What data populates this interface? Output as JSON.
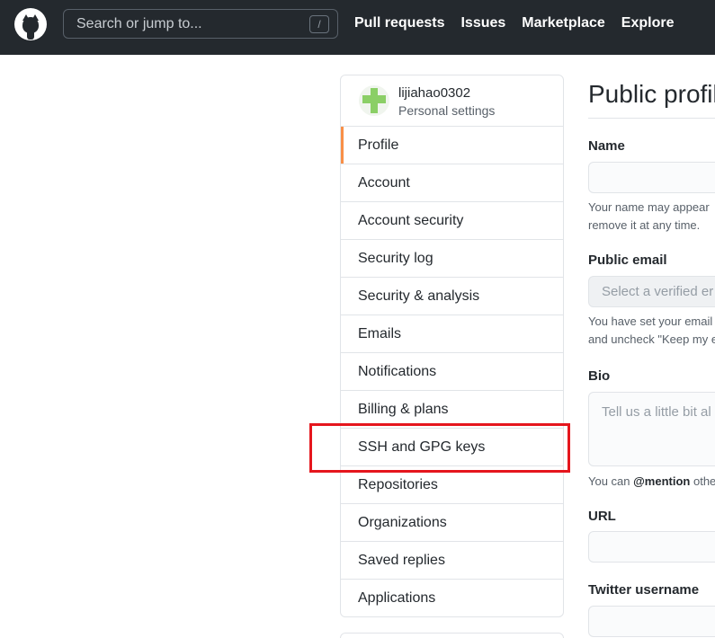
{
  "header": {
    "search_placeholder": "Search or jump to...",
    "search_shortcut": "/",
    "nav": [
      "Pull requests",
      "Issues",
      "Marketplace",
      "Explore"
    ]
  },
  "sidebar": {
    "username": "lijiahao0302",
    "subtitle": "Personal settings",
    "items": [
      {
        "label": "Profile",
        "selected": true
      },
      {
        "label": "Account"
      },
      {
        "label": "Account security"
      },
      {
        "label": "Security log"
      },
      {
        "label": "Security & analysis"
      },
      {
        "label": "Emails"
      },
      {
        "label": "Notifications"
      },
      {
        "label": "Billing & plans"
      },
      {
        "label": "SSH and GPG keys",
        "highlighted": true
      },
      {
        "label": "Repositories"
      },
      {
        "label": "Organizations"
      },
      {
        "label": "Saved replies"
      },
      {
        "label": "Applications"
      }
    ]
  },
  "main": {
    "title": "Public profil",
    "name_label": "Name",
    "name_note_1": "Your name may appear",
    "name_note_2": "remove it at any time.",
    "email_label": "Public email",
    "email_placeholder": "Select a verified er",
    "email_note_1": "You have set your email",
    "email_note_2": "and uncheck \"Keep my e",
    "bio_label": "Bio",
    "bio_placeholder": "Tell us a little bit al",
    "bio_note_prefix": "You can ",
    "bio_note_mention": "@mention",
    "bio_note_suffix": " othe",
    "url_label": "URL",
    "twitter_label": "Twitter username"
  },
  "colors": {
    "header_bg": "#24292e",
    "selected_marker": "#f66a0a",
    "highlight_box": "#e5161d"
  }
}
